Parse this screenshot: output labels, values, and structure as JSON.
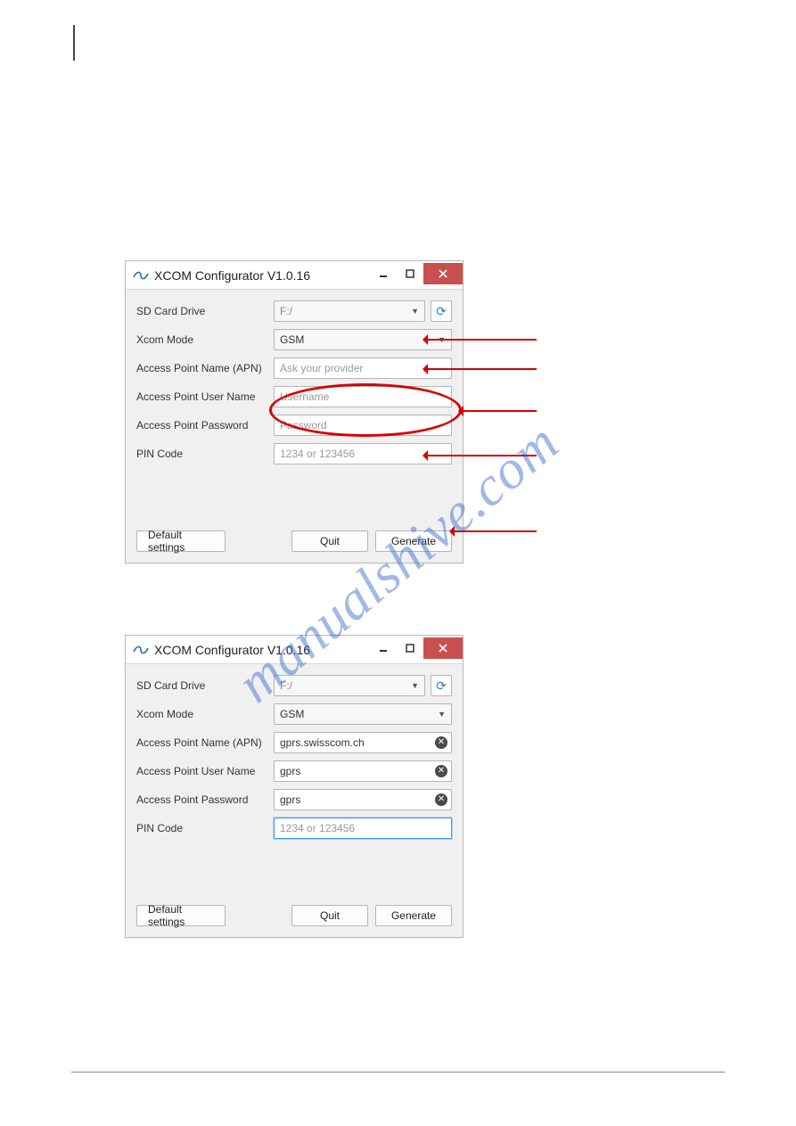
{
  "watermark_text": "manualshive.com",
  "window1": {
    "title": "XCOM Configurator V1.0.16",
    "labels": {
      "sd_card": "SD Card Drive",
      "xcom_mode": "Xcom Mode",
      "apn": "Access Point Name (APN)",
      "ap_user": "Access Point User Name",
      "ap_pass": "Access Point Password",
      "pin": "PIN Code"
    },
    "values": {
      "sd_card": "F:/",
      "xcom_mode": "GSM"
    },
    "placeholders": {
      "apn": "Ask your provider",
      "ap_user": "Username",
      "ap_pass": "Password",
      "pin": "1234 or 123456"
    },
    "buttons": {
      "default": "Default settings",
      "quit": "Quit",
      "generate": "Generate"
    }
  },
  "window2": {
    "title": "XCOM Configurator V1.0.16",
    "labels": {
      "sd_card": "SD Card Drive",
      "xcom_mode": "Xcom Mode",
      "apn": "Access Point Name (APN)",
      "ap_user": "Access Point User Name",
      "ap_pass": "Access Point Password",
      "pin": "PIN Code"
    },
    "values": {
      "sd_card": "F:/",
      "xcom_mode": "GSM",
      "apn": "gprs.swisscom.ch",
      "ap_user": "gprs",
      "ap_pass": "gprs"
    },
    "placeholders": {
      "pin": "1234 or 123456"
    },
    "buttons": {
      "default": "Default settings",
      "quit": "Quit",
      "generate": "Generate"
    }
  }
}
